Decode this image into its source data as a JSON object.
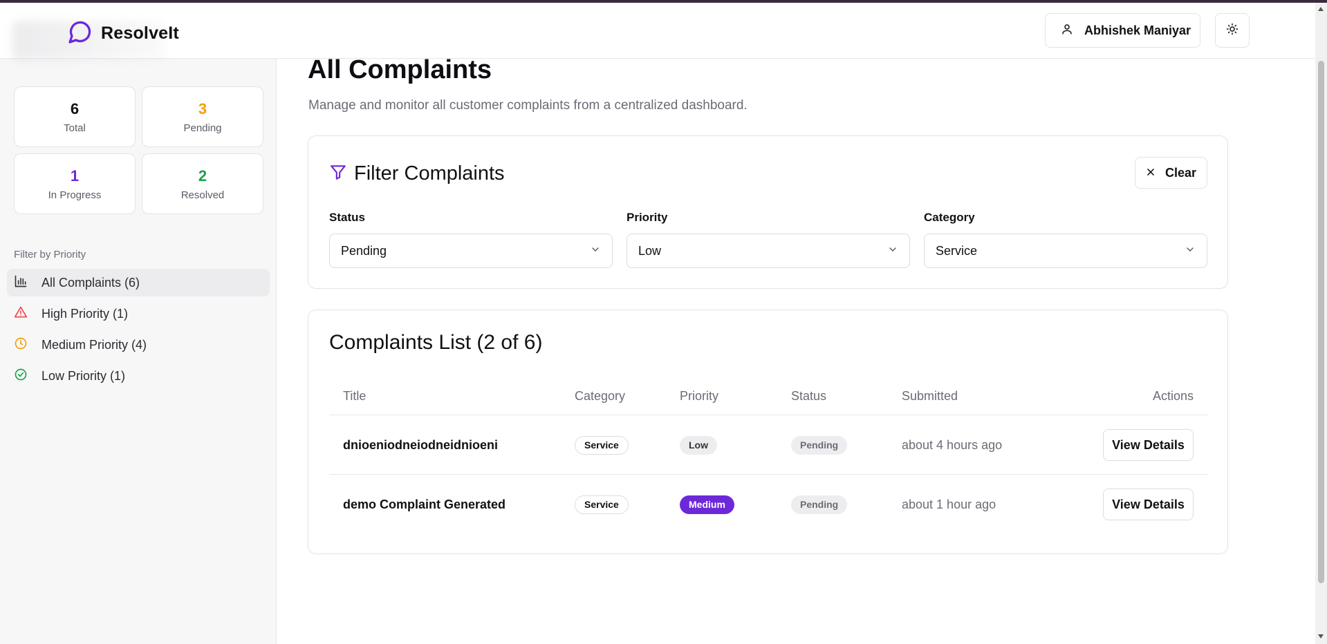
{
  "app": {
    "name": "ResolveIt"
  },
  "header": {
    "user_name": "Abhishek Maniyar",
    "user_icon": "user-icon",
    "theme_icon": "sun-icon"
  },
  "sidebar": {
    "stats": [
      {
        "value": "6",
        "label": "Total",
        "color": "#111111"
      },
      {
        "value": "3",
        "label": "Pending",
        "color": "#f59e0b"
      },
      {
        "value": "1",
        "label": "In Progress",
        "color": "#6d28d9"
      },
      {
        "value": "2",
        "label": "Resolved",
        "color": "#16a34a"
      }
    ],
    "filter_title": "Filter by Priority",
    "priority_items": [
      {
        "label": "All Complaints (6)",
        "icon": "bar-chart-icon",
        "active": true
      },
      {
        "label": "High Priority (1)",
        "icon": "alert-triangle-icon",
        "color": "#ef4444"
      },
      {
        "label": "Medium Priority (4)",
        "icon": "clock-icon",
        "color": "#f59e0b"
      },
      {
        "label": "Low Priority (1)",
        "icon": "check-circle-icon",
        "color": "#16a34a"
      }
    ]
  },
  "main": {
    "title": "All Complaints",
    "subtitle": "Manage and monitor all customer complaints from a centralized dashboard.",
    "filter": {
      "title": "Filter Complaints",
      "clear_label": "Clear",
      "fields": [
        {
          "label": "Status",
          "value": "Pending"
        },
        {
          "label": "Priority",
          "value": "Low"
        },
        {
          "label": "Category",
          "value": "Service"
        }
      ]
    },
    "list": {
      "title": "Complaints List (2 of 6)",
      "columns": [
        "Title",
        "Category",
        "Priority",
        "Status",
        "Submitted",
        "Actions"
      ],
      "rows": [
        {
          "title": "dnioeniodneiodneidnioeni",
          "category": "Service",
          "priority": "Low",
          "status": "Pending",
          "submitted": "about 4 hours ago",
          "action": "View Details"
        },
        {
          "title": "demo Complaint Generated",
          "category": "Service",
          "priority": "Medium",
          "status": "Pending",
          "submitted": "about 1 hour ago",
          "action": "View Details"
        }
      ]
    }
  },
  "colors": {
    "accent": "#6d28d9",
    "border": "#e3e3e8"
  }
}
